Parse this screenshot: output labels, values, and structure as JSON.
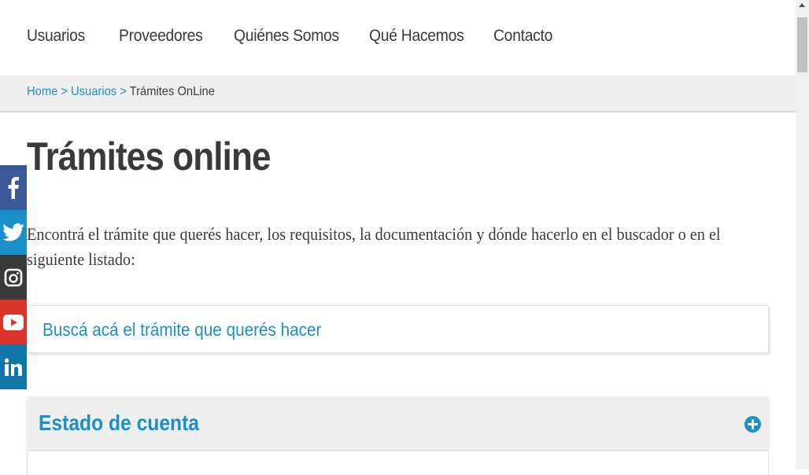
{
  "nav": {
    "items": [
      "Usuarios",
      "Proveedores",
      "Quiénes Somos",
      "Qué Hacemos",
      "Contacto"
    ]
  },
  "breadcrumb": {
    "home": "Home",
    "sep1": " > ",
    "usuarios": "Usuarios",
    "sep2": " > ",
    "current": "Trámites OnLine"
  },
  "main": {
    "title": "Trámites online",
    "intro": "Encontrá el trámite que querés hacer, los requisitos, la documentación y dónde hacerlo en el buscador o en el siguiente listado:",
    "search_prompt": "Buscá acá el trámite que querés hacer",
    "accordion_title": "Estado de cuenta"
  },
  "social": [
    {
      "icon": "facebook-icon",
      "color": "#3b5998"
    },
    {
      "icon": "twitter-icon",
      "color": "#1a8fc9"
    },
    {
      "icon": "instagram-icon",
      "color": "#3a3a3a"
    },
    {
      "icon": "youtube-icon",
      "color": "#d9352b"
    },
    {
      "icon": "linkedin-icon",
      "color": "#0e76a8"
    }
  ],
  "colors": {
    "accent": "#1a8fc9",
    "text": "#3a3a3a",
    "panel": "#efeff0"
  }
}
